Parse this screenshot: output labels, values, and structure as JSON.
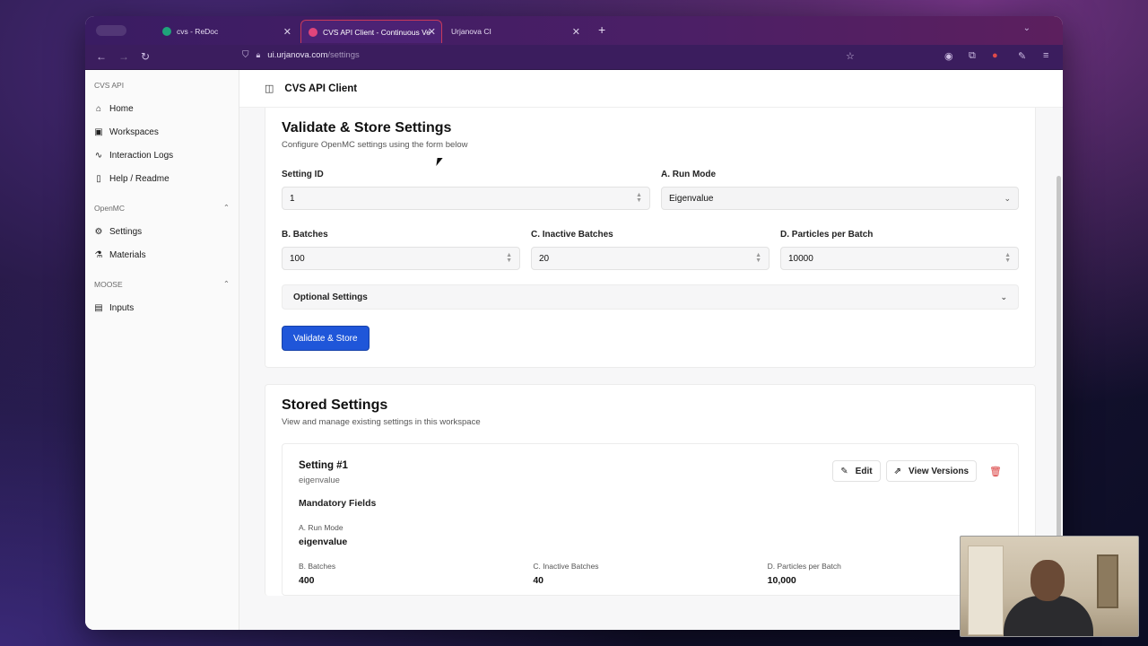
{
  "browser": {
    "tabs": [
      {
        "label": "cvs - ReDoc",
        "icon_color": "#1fa37a"
      },
      {
        "label": "CVS API Client - Continuous Ve",
        "icon_color": "#e0457b"
      },
      {
        "label": "Urjanova CI",
        "icon_color": ""
      }
    ],
    "url_host": "ui.urjanova.com",
    "url_path": "/settings"
  },
  "sidebar": {
    "group_api": "CVS API",
    "api_items": [
      {
        "label": "Home",
        "icon": "home-icon"
      },
      {
        "label": "Workspaces",
        "icon": "workspaces-icon"
      },
      {
        "label": "Interaction Logs",
        "icon": "activity-icon"
      },
      {
        "label": "Help / Readme",
        "icon": "book-icon"
      }
    ],
    "group_openmc": "OpenMC",
    "openmc_items": [
      {
        "label": "Settings",
        "icon": "gear-icon"
      },
      {
        "label": "Materials",
        "icon": "flask-icon"
      }
    ],
    "group_moose": "MOOSE",
    "moose_items": [
      {
        "label": "Inputs",
        "icon": "file-icon"
      }
    ]
  },
  "header": {
    "title": "CVS API Client"
  },
  "form": {
    "title": "Validate & Store Settings",
    "subtitle": "Configure OpenMC settings using the form below",
    "setting_id_label": "Setting ID",
    "setting_id_value": "1",
    "run_mode_label": "A. Run Mode",
    "run_mode_value": "Eigenvalue",
    "batches_label": "B. Batches",
    "batches_value": "100",
    "inactive_label": "C. Inactive Batches",
    "inactive_value": "20",
    "particles_label": "D. Particles per Batch",
    "particles_value": "10000",
    "optional_label": "Optional Settings",
    "submit_label": "Validate & Store"
  },
  "stored": {
    "title": "Stored Settings",
    "subtitle": "View and manage existing settings in this workspace",
    "item": {
      "title": "Setting #1",
      "mode": "eigenvalue",
      "section": "Mandatory Fields",
      "run_mode_label": "A. Run Mode",
      "run_mode_value": "eigenvalue",
      "batches_label": "B. Batches",
      "batches_value": "400",
      "inactive_label": "C. Inactive Batches",
      "inactive_value": "40",
      "particles_label": "D. Particles per Batch",
      "particles_value": "10,000",
      "edit_label": "Edit",
      "versions_label": "View Versions"
    }
  },
  "colors": {
    "primary": "#1f56d9",
    "danger": "#d93b3b"
  }
}
